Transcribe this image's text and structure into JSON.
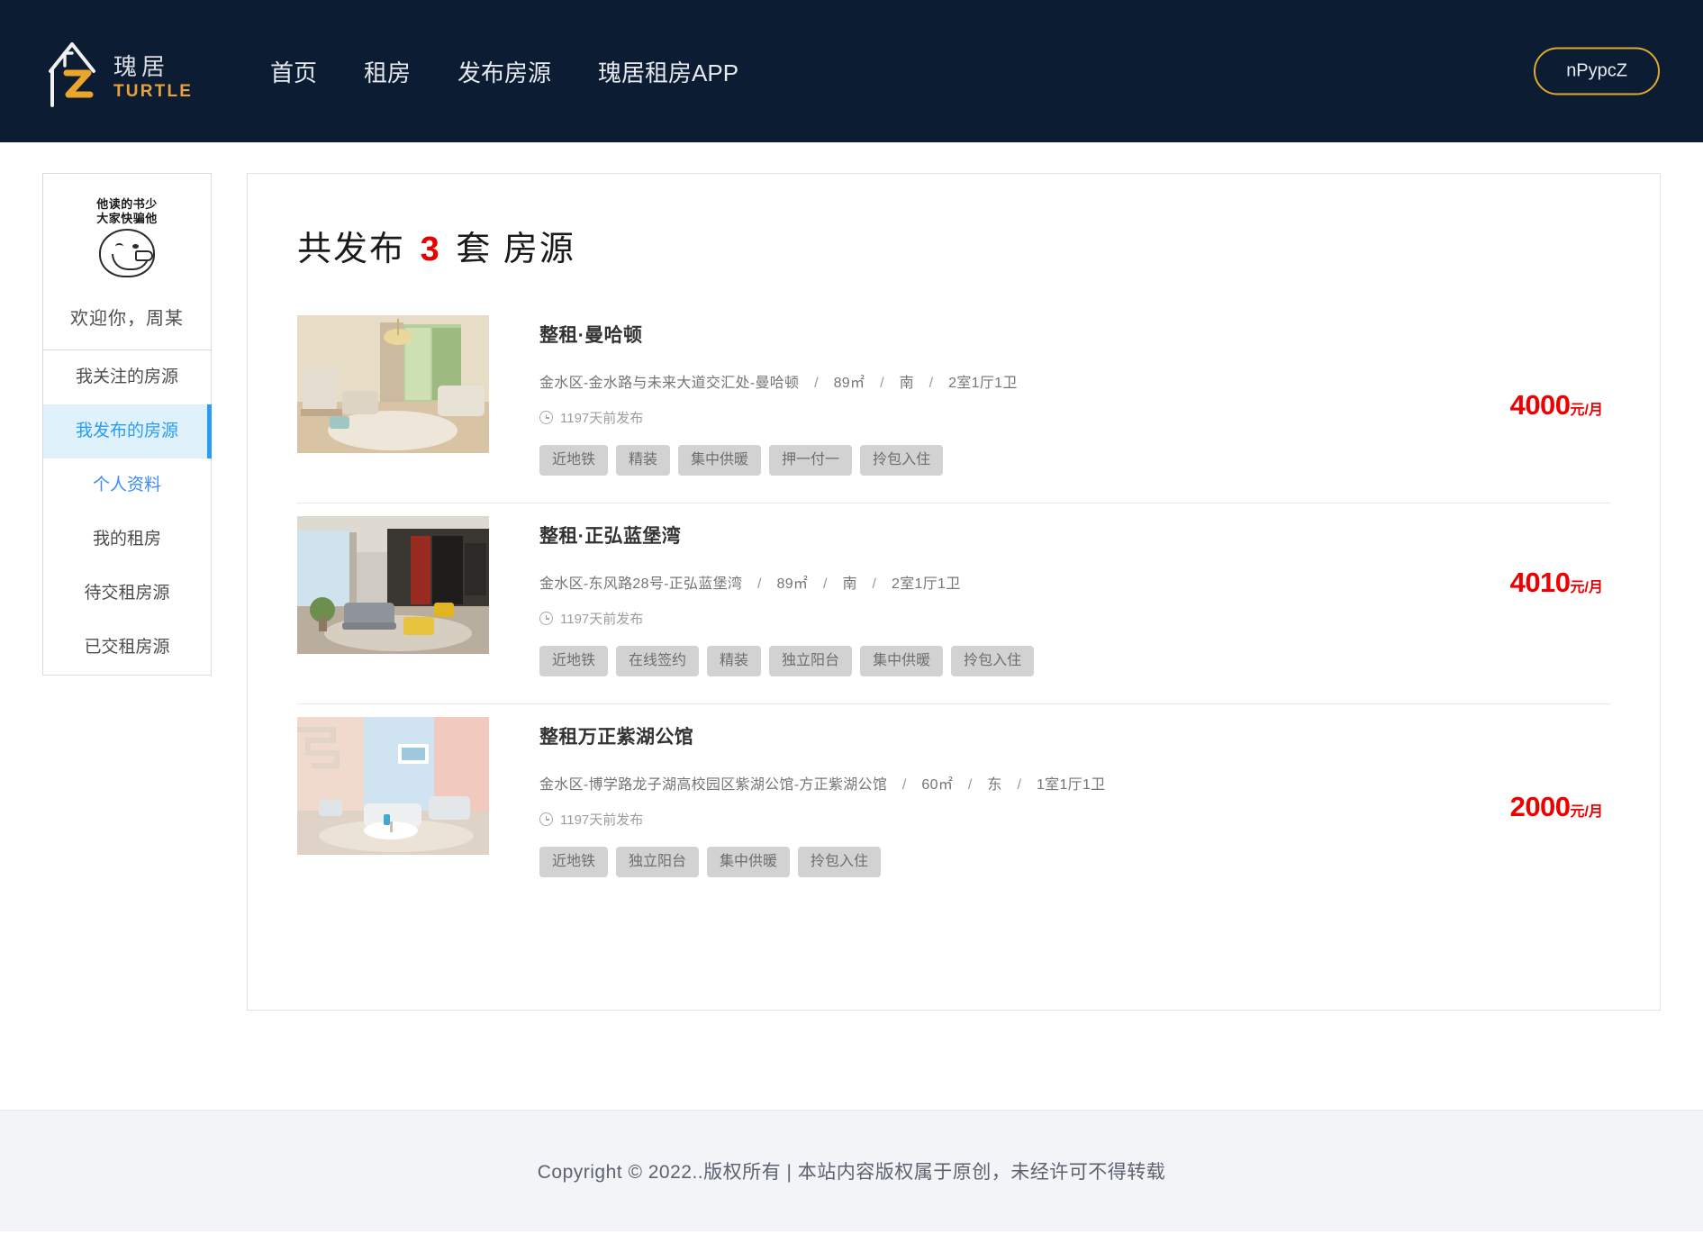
{
  "header": {
    "logo": {
      "cn": "瑰居",
      "en": "TURTLE",
      "icon": "house-logo-icon"
    },
    "nav": [
      {
        "label": "首页",
        "name": "nav-home"
      },
      {
        "label": "租房",
        "name": "nav-rent"
      },
      {
        "label": "发布房源",
        "name": "nav-publish"
      },
      {
        "label": "瑰居租房APP",
        "name": "nav-app"
      }
    ],
    "user_button": "nPypcZ",
    "bg_color": "#0b1c33",
    "accent_color": "#e0ab2b"
  },
  "sidebar": {
    "avatar_caption_line1": "他读的书少",
    "avatar_caption_line2": "大家快骗他",
    "welcome": "欢迎你，周某",
    "items": [
      {
        "label": "我关注的房源",
        "state": "normal"
      },
      {
        "label": "我发布的房源",
        "state": "active"
      },
      {
        "label": "个人资料",
        "state": "link"
      },
      {
        "label": "我的租房",
        "state": "normal"
      },
      {
        "label": "待交租房源",
        "state": "normal"
      },
      {
        "label": "已交租房源",
        "state": "normal"
      }
    ]
  },
  "main": {
    "title_prefix": "共发布",
    "count": "3",
    "title_suffix": "套 房源",
    "listings": [
      {
        "title": "整租·曼哈顿",
        "address": "金水区-金水路与未来大道交汇处-曼哈顿",
        "area": "89",
        "area_unit": "㎡",
        "orientation": "南",
        "layout": "2室1厅1卫",
        "time": "1197天前发布",
        "price": "4000",
        "price_unit": "元/月",
        "tags": [
          "近地铁",
          "精装",
          "集中供暖",
          "押一付一",
          "拎包入住"
        ],
        "image_theme": "living-room-warm"
      },
      {
        "title": "整租·正弘蓝堡湾",
        "address": "金水区-东风路28号-正弘蓝堡湾",
        "area": "89",
        "area_unit": "㎡",
        "orientation": "南",
        "layout": "2室1厅1卫",
        "time": "1197天前发布",
        "price": "4010",
        "price_unit": "元/月",
        "tags": [
          "近地铁",
          "在线签约",
          "精装",
          "独立阳台",
          "集中供暖",
          "拎包入住"
        ],
        "image_theme": "living-room-dark"
      },
      {
        "title": "整租万正紫湖公馆",
        "address": "金水区-博学路龙子湖高校园区紫湖公馆-方正紫湖公馆",
        "area": "60",
        "area_unit": "㎡",
        "orientation": "东",
        "layout": "1室1厅1卫",
        "time": "1197天前发布",
        "price": "2000",
        "price_unit": "元/月",
        "tags": [
          "近地铁",
          "独立阳台",
          "集中供暖",
          "拎包入住"
        ],
        "image_theme": "living-room-pastel"
      }
    ]
  },
  "footer": {
    "text": "Copyright © 2022..版权所有 | 本站内容版权属于原创，未经许可不得转载"
  }
}
